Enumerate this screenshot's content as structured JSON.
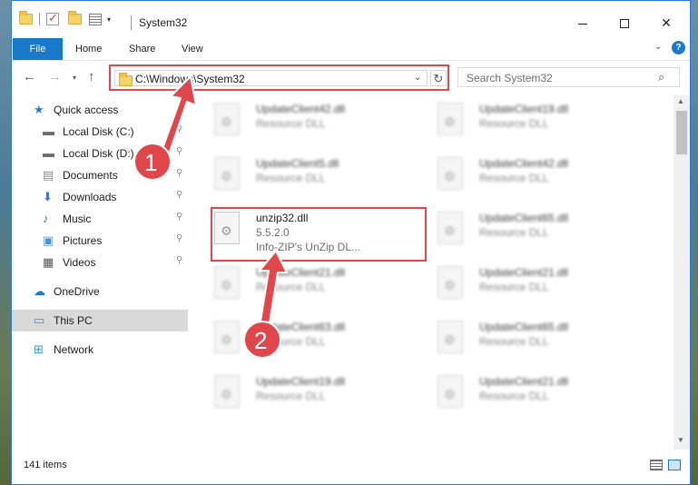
{
  "titlebar": {
    "title": "System32",
    "qat_dropdown": "▾",
    "minimize_label": "",
    "close_glyph": "✕"
  },
  "ribbon": {
    "tabs": [
      "File",
      "Home",
      "Share",
      "View"
    ],
    "collapse_glyph": "⌄",
    "help_glyph": "?"
  },
  "nav": {
    "back_glyph": "←",
    "forward_glyph": "→",
    "recent_glyph": "▾",
    "up_glyph": "↑",
    "address": "C:\\Windows\\System32",
    "address_chevron": "⌄",
    "refresh_glyph": "↻",
    "search_placeholder": "Search System32",
    "search_glyph": "⌕"
  },
  "sidebar": {
    "items": [
      {
        "label": "Quick access",
        "icon": "star-icon"
      },
      {
        "label": "Local Disk (C:)",
        "icon": "drive-icon",
        "pinned": true
      },
      {
        "label": "Local Disk (D:)",
        "icon": "drive-icon",
        "pinned": true
      },
      {
        "label": "Documents",
        "icon": "documents-icon",
        "pinned": true
      },
      {
        "label": "Downloads",
        "icon": "download-icon",
        "pinned": true
      },
      {
        "label": "Music",
        "icon": "music-icon",
        "pinned": true
      },
      {
        "label": "Pictures",
        "icon": "pictures-icon",
        "pinned": true
      },
      {
        "label": "Videos",
        "icon": "videos-icon",
        "pinned": true
      },
      {
        "label": "OneDrive",
        "icon": "cloud-icon"
      },
      {
        "label": "This PC",
        "icon": "monitor-icon",
        "selected": true
      },
      {
        "label": "Network",
        "icon": "network-icon"
      }
    ],
    "pin_glyph": "📌"
  },
  "files": [
    {
      "name": "UpdateClient42.dll",
      "type": "Resource DLL",
      "blurred": true
    },
    {
      "name": "UpdateClient19.dll",
      "type": "Resource DLL",
      "blurred": true
    },
    {
      "name": "UpdateClient5.dll",
      "type": "Resource DLL",
      "blurred": true
    },
    {
      "name": "UpdateClient42.dll",
      "type": "Resource DLL",
      "blurred": true
    },
    {
      "name": "unzip32.dll",
      "version": "5.5.2.0",
      "type": "Info-ZIP's UnZip DL...",
      "blurred": false
    },
    {
      "name": "UpdateClient65.dll",
      "type": "Resource DLL",
      "blurred": true
    },
    {
      "name": "UpdateClient21.dll",
      "type": "Resource DLL",
      "blurred": true
    },
    {
      "name": "UpdateClient21.dll",
      "type": "Resource DLL",
      "blurred": true
    },
    {
      "name": "UpdateClient63.dll",
      "type": "Resource DLL",
      "blurred": true
    },
    {
      "name": "UpdateClient65.dll",
      "type": "Resource DLL",
      "blurred": true
    },
    {
      "name": "UpdateClient19.dll",
      "type": "Resource DLL",
      "blurred": true
    },
    {
      "name": "UpdateClient21.dll",
      "type": "Resource DLL",
      "blurred": true
    }
  ],
  "status": {
    "item_count": "141 items"
  },
  "annotations": {
    "step1": "1",
    "step2": "2",
    "color": "#e0474c"
  }
}
